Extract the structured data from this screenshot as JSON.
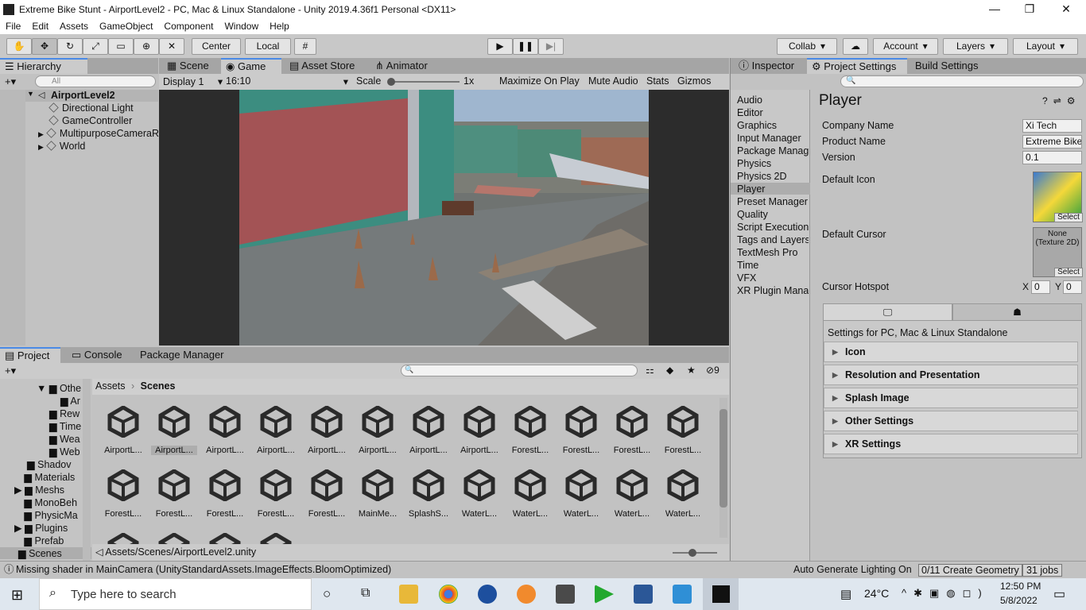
{
  "window": {
    "title": "Extreme Bike Stunt - AirportLevel2 - PC, Mac & Linux Standalone - Unity 2019.4.36f1 Personal <DX11>",
    "min": "—",
    "max": "❐",
    "close": "✕"
  },
  "menu": [
    "File",
    "Edit",
    "Assets",
    "GameObject",
    "Component",
    "Window",
    "Help"
  ],
  "toolbar": {
    "center": "Center",
    "local": "Local",
    "collab": "Collab",
    "account": "Account",
    "layers": "Layers",
    "layout": "Layout"
  },
  "hierarchy": {
    "tab": "Hierarchy",
    "search_placeholder": "All",
    "scene": "AirportLevel2",
    "items": [
      "Directional Light",
      "GameController",
      "MultipurposeCameraR",
      "World"
    ]
  },
  "game_tabs": {
    "scene": "Scene",
    "game": "Game",
    "asset_store": "Asset Store",
    "animator": "Animator"
  },
  "game_bar": {
    "display": "Display 1",
    "aspect": "16:10",
    "scale_label": "Scale",
    "scale_value": "1x",
    "maximize": "Maximize On Play",
    "mute": "Mute Audio",
    "stats": "Stats",
    "gizmos": "Gizmos"
  },
  "inspector_tabs": {
    "inspector": "Inspector",
    "project_settings": "Project Settings",
    "build_settings": "Build Settings"
  },
  "settings_list": [
    "Audio",
    "Editor",
    "Graphics",
    "Input Manager",
    "Package Manager",
    "Physics",
    "Physics 2D",
    "Player",
    "Preset Manager",
    "Quality",
    "Script Execution",
    "Tags and Layers",
    "TextMesh Pro",
    "Time",
    "VFX",
    "XR Plugin Management"
  ],
  "player": {
    "title": "Player",
    "company_label": "Company Name",
    "company_value": "Xi Tech",
    "product_label": "Product Name",
    "product_value": "Extreme Bike",
    "version_label": "Version",
    "version_value": "0.1",
    "default_icon_label": "Default Icon",
    "select": "Select",
    "default_cursor_label": "Default Cursor",
    "cursor_none": "None\n(Texture 2D)",
    "hotspot_label": "Cursor Hotspot",
    "hx_label": "X",
    "hx_value": "0",
    "hy_label": "Y",
    "hy_value": "0",
    "platform_text": "Settings for PC, Mac & Linux Standalone",
    "sections": [
      "Icon",
      "Resolution and Presentation",
      "Splash Image",
      "Other Settings",
      "XR Settings"
    ]
  },
  "project": {
    "tab": "Project",
    "console": "Console",
    "package_manager": "Package Manager",
    "hidden_count": "9",
    "breadcrumb_root": "Assets",
    "breadcrumb_leaf": "Scenes",
    "path": "Assets/Scenes/AirportLevel2.unity",
    "folders": [
      "Othe",
      "Ar",
      "Rew",
      "Time",
      "Wea",
      "Web",
      "Shadov",
      "Materials",
      "Meshs",
      "MonoBeh",
      "PhysicMa",
      "Plugins",
      "Prefab",
      "Scenes"
    ],
    "assets_row1": [
      "AirportL...",
      "AirportL...",
      "AirportL...",
      "AirportL...",
      "AirportL...",
      "AirportL...",
      "AirportL...",
      "AirportL...",
      "ForestL...",
      "ForestL...",
      "ForestL...",
      "ForestL..."
    ],
    "assets_row2": [
      "ForestL...",
      "ForestL...",
      "ForestL...",
      "ForestL...",
      "ForestL...",
      "MainMe...",
      "SplashS...",
      "WaterL...",
      "WaterL...",
      "WaterL...",
      "WaterL...",
      "WaterL..."
    ]
  },
  "status": {
    "message": "Missing shader in MainCamera (UnityStandardAssets.ImageEffects.BloomOptimized)",
    "lighting": "Auto Generate Lighting On",
    "geometry": "0/11 Create Geometry",
    "jobs": "31 jobs"
  },
  "taskbar": {
    "search_placeholder": "Type here to search",
    "weather": "24°C",
    "time": "12:50 PM",
    "date": "5/8/2022"
  }
}
